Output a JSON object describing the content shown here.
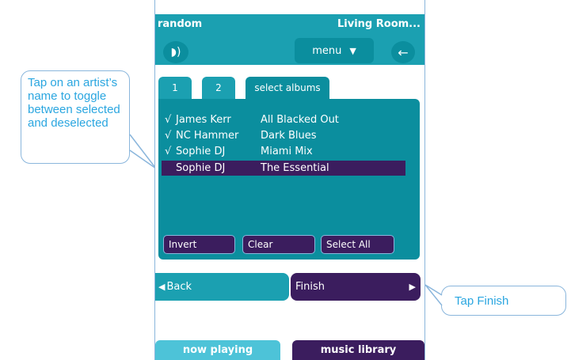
{
  "header": {
    "left_title": "random",
    "right_title": "Living Room..."
  },
  "toolbar": {
    "menu_label": "menu"
  },
  "tabs": [
    {
      "label": "1",
      "active": false
    },
    {
      "label": "2",
      "active": false
    },
    {
      "label": "select albums",
      "active": true
    }
  ],
  "albums": [
    {
      "checked": true,
      "check_mark": "√",
      "artist": "James Kerr",
      "album": "All Blacked Out",
      "highlighted": false
    },
    {
      "checked": true,
      "check_mark": "√",
      "artist": "NC Hammer",
      "album": "Dark Blues",
      "highlighted": false
    },
    {
      "checked": true,
      "check_mark": "√",
      "artist": "Sophie DJ",
      "album": "Miami Mix",
      "highlighted": false
    },
    {
      "checked": false,
      "check_mark": "",
      "artist": "Sophie DJ",
      "album": "The Essential",
      "highlighted": true
    }
  ],
  "panel_buttons": {
    "invert": "Invert",
    "clear": "Clear",
    "select_all": "Select All"
  },
  "nav": {
    "back": "Back",
    "finish": "Finish"
  },
  "bottom_tabs": {
    "now_playing": "now playing",
    "music_library": "music library"
  },
  "callouts": {
    "artist_tip": "Tap on an artist’s name to toggle between selected and deselected",
    "finish_tip": "Tap Finish"
  },
  "colors": {
    "teal": "#1ba0b1",
    "dark_teal": "#0b8e9e",
    "purple": "#3b1d5e",
    "callout_text": "#2aa6e0"
  }
}
